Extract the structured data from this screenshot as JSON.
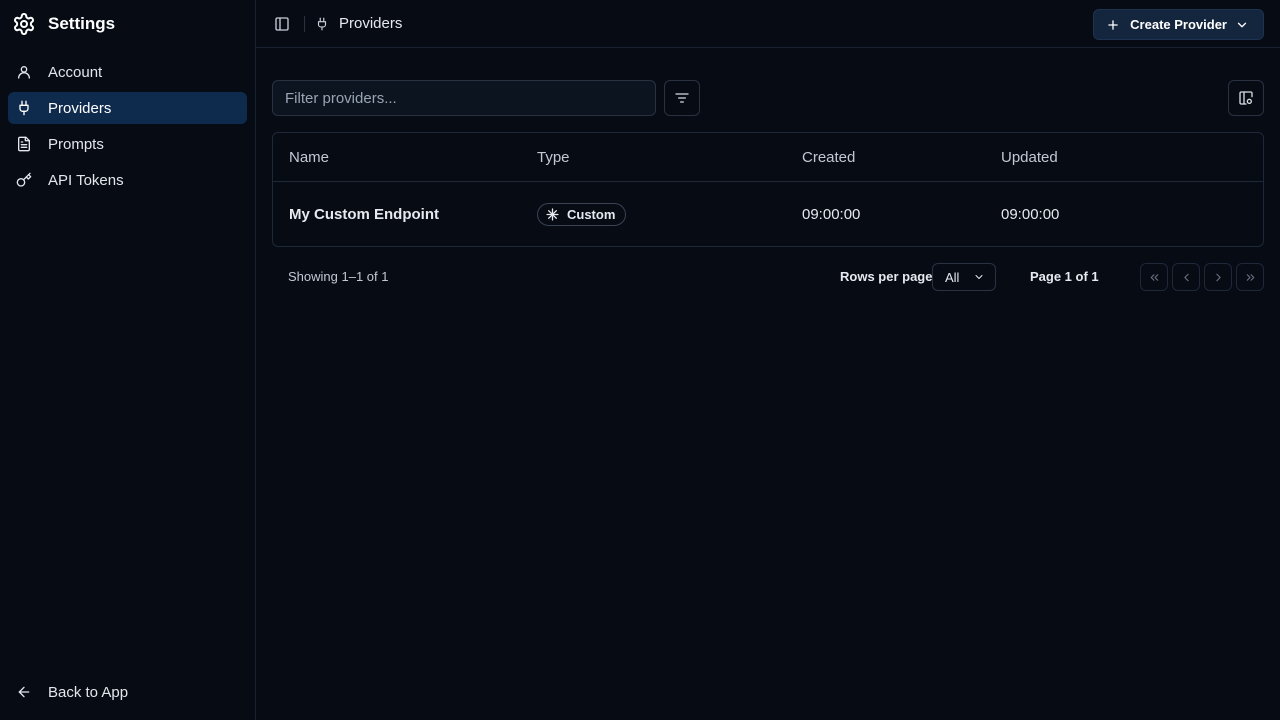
{
  "sidebar": {
    "title": "Settings",
    "items": [
      {
        "label": "Account",
        "icon": "user-icon",
        "active": false
      },
      {
        "label": "Providers",
        "icon": "plug-icon",
        "active": true
      },
      {
        "label": "Prompts",
        "icon": "document-icon",
        "active": false
      },
      {
        "label": "API Tokens",
        "icon": "key-icon",
        "active": false
      }
    ],
    "back_label": "Back to App"
  },
  "header": {
    "breadcrumb": "Providers",
    "create_label": "Create Provider"
  },
  "toolbar": {
    "filter_placeholder": "Filter providers...",
    "filter_value": ""
  },
  "table": {
    "columns": [
      "Name",
      "Type",
      "Created",
      "Updated"
    ],
    "rows": [
      {
        "name": "My Custom Endpoint",
        "type": "Custom",
        "created": "09:00:00",
        "updated": "09:00:00"
      }
    ]
  },
  "pagination": {
    "showing": "Showing 1–1 of 1",
    "rows_per_page_label": "Rows per page",
    "rows_per_page_value": "All",
    "page_info": "Page 1 of 1"
  },
  "colors": {
    "background": "#060b14",
    "active_nav": "#0e2a4d",
    "button": "#14263d",
    "border": "#1f2838"
  }
}
